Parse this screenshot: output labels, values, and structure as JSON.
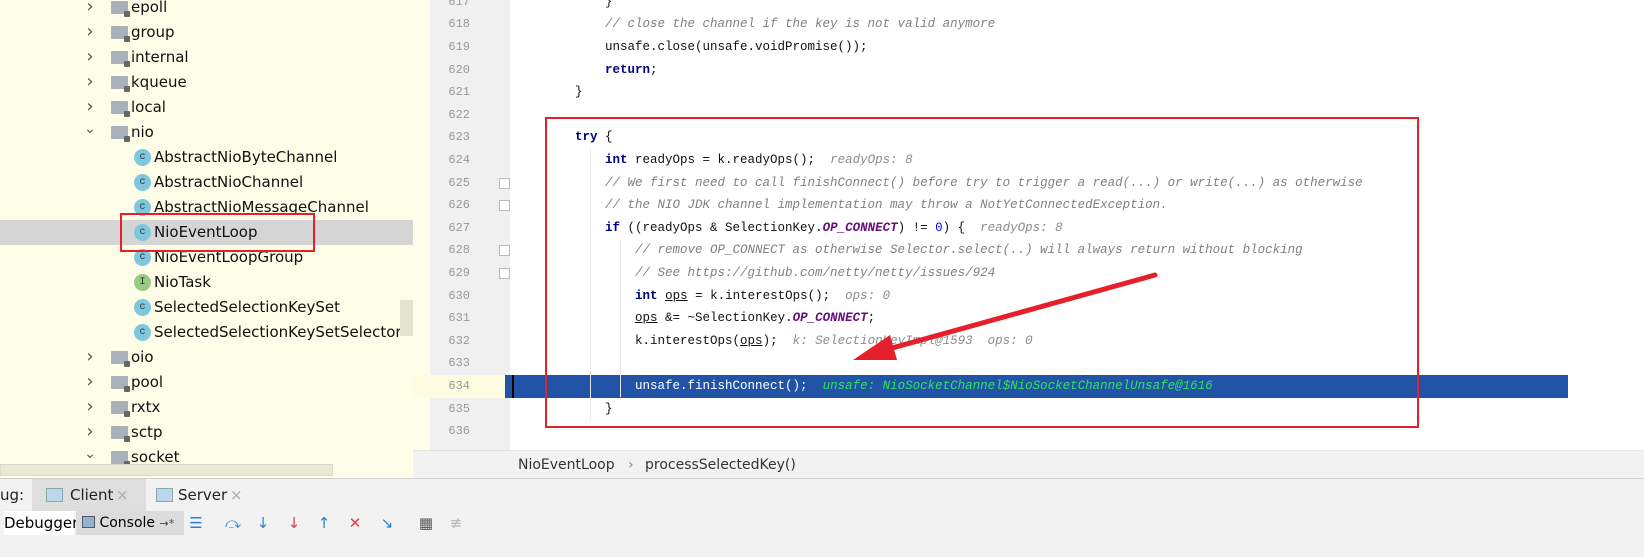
{
  "tree": [
    {
      "type": "folder",
      "label": "epoll",
      "expanded": false,
      "depth": 1
    },
    {
      "type": "folder",
      "label": "group",
      "expanded": false,
      "depth": 1
    },
    {
      "type": "folder",
      "label": "internal",
      "expanded": false,
      "depth": 1
    },
    {
      "type": "folder",
      "label": "kqueue",
      "expanded": false,
      "depth": 1
    },
    {
      "type": "folder",
      "label": "local",
      "expanded": false,
      "depth": 1
    },
    {
      "type": "folder",
      "label": "nio",
      "expanded": true,
      "depth": 1
    },
    {
      "type": "class",
      "label": "AbstractNioByteChannel",
      "depth": 2
    },
    {
      "type": "class",
      "label": "AbstractNioChannel",
      "depth": 2
    },
    {
      "type": "class",
      "label": "AbstractNioMessageChannel",
      "depth": 2
    },
    {
      "type": "class",
      "label": "NioEventLoop",
      "depth": 2,
      "selected": true
    },
    {
      "type": "class",
      "label": "NioEventLoopGroup",
      "depth": 2
    },
    {
      "type": "interface",
      "label": "NioTask",
      "depth": 2
    },
    {
      "type": "class",
      "label": "SelectedSelectionKeySet",
      "depth": 2
    },
    {
      "type": "class",
      "label": "SelectedSelectionKeySetSelector",
      "depth": 2
    },
    {
      "type": "folder",
      "label": "oio",
      "expanded": false,
      "depth": 1
    },
    {
      "type": "folder",
      "label": "pool",
      "expanded": false,
      "depth": 1
    },
    {
      "type": "folder",
      "label": "rxtx",
      "expanded": false,
      "depth": 1
    },
    {
      "type": "folder",
      "label": "sctp",
      "expanded": false,
      "depth": 1
    },
    {
      "type": "folder",
      "label": "socket",
      "expanded": true,
      "depth": 1
    }
  ],
  "editor": {
    "highlight_line": 634,
    "lines": [
      {
        "n": "617",
        "seg": [
          [
            "            }",
            ""
          ]
        ]
      },
      {
        "n": "618",
        "seg": [
          [
            "            // close the channel if the key is not valid anymore",
            "cm"
          ]
        ]
      },
      {
        "n": "619",
        "seg": [
          [
            "            unsafe.close(unsafe.voidPromise());",
            ""
          ]
        ]
      },
      {
        "n": "620",
        "seg": [
          [
            "            ",
            ""
          ],
          [
            "return",
            "kw"
          ],
          [
            ";",
            ""
          ]
        ]
      },
      {
        "n": "621",
        "seg": [
          [
            "        }",
            ""
          ]
        ]
      },
      {
        "n": "622",
        "seg": []
      },
      {
        "n": "623",
        "seg": [
          [
            "        ",
            ""
          ],
          [
            "try",
            "kw"
          ],
          [
            " {",
            ""
          ]
        ]
      },
      {
        "n": "624",
        "seg": [
          [
            "            ",
            ""
          ],
          [
            "int",
            "kw"
          ],
          [
            " readyOps = k.readyOps();  ",
            ""
          ],
          [
            "readyOps: 8",
            "hint"
          ]
        ]
      },
      {
        "n": "625",
        "seg": [
          [
            "            // We first need to call finishConnect() before try to trigger a read(...) or write(...) as otherwise",
            "cm"
          ]
        ]
      },
      {
        "n": "626",
        "seg": [
          [
            "            // the NIO JDK channel implementation may throw a NotYetConnectedException.",
            "cm"
          ]
        ]
      },
      {
        "n": "627",
        "seg": [
          [
            "            ",
            ""
          ],
          [
            "if",
            "kw"
          ],
          [
            " ((readyOps & SelectionKey.",
            ""
          ],
          [
            "OP_CONNECT",
            "cst"
          ],
          [
            ") != ",
            ""
          ],
          [
            "0",
            "num"
          ],
          [
            ") {  ",
            ""
          ],
          [
            "readyOps: 8",
            "hint"
          ]
        ]
      },
      {
        "n": "628",
        "seg": [
          [
            "                // remove OP_CONNECT as otherwise Selector.select(..) will always return without blocking",
            "cm"
          ]
        ]
      },
      {
        "n": "629",
        "seg": [
          [
            "                // See https://github.com/netty/netty/issues/924",
            "cm"
          ]
        ]
      },
      {
        "n": "630",
        "seg": [
          [
            "                ",
            ""
          ],
          [
            "int",
            "kw"
          ],
          [
            " ",
            ""
          ],
          [
            "ops",
            "ul"
          ],
          [
            " = k.interestOps();  ",
            ""
          ],
          [
            "ops: 0",
            "hint"
          ]
        ]
      },
      {
        "n": "631",
        "seg": [
          [
            "                ",
            ""
          ],
          [
            "ops",
            "ul"
          ],
          [
            " &= ~SelectionKey.",
            ""
          ],
          [
            "OP_CONNECT",
            "cst"
          ],
          [
            ";",
            ""
          ]
        ]
      },
      {
        "n": "632",
        "seg": [
          [
            "                k.interestOps(",
            ""
          ],
          [
            "ops",
            "ul"
          ],
          [
            ");  ",
            ""
          ],
          [
            "k: SelectionKeyImpl@1593  ops: 0",
            "hint"
          ]
        ]
      },
      {
        "n": "633",
        "seg": []
      },
      {
        "n": "634",
        "seg": [
          [
            "                unsafe.finishConnect();  ",
            ""
          ],
          [
            "unsafe: NioSocketChannel$NioSocketChannelUnsafe@1616",
            "hint"
          ]
        ]
      },
      {
        "n": "635",
        "seg": [
          [
            "            }",
            ""
          ]
        ]
      },
      {
        "n": "636",
        "seg": []
      }
    ]
  },
  "breadcrumb": {
    "items": [
      "NioEventLoop",
      "processSelectedKey()"
    ],
    "separator": "›"
  },
  "debug": {
    "label": "ug:",
    "tabs": [
      {
        "label": "Client",
        "active": true,
        "close": "×"
      },
      {
        "label": "Server",
        "active": false,
        "close": "×"
      }
    ],
    "toolbar": {
      "debugger": "Debugger",
      "console": "Console",
      "console_pin": "→*"
    }
  },
  "colors": {
    "selection": "#2154a6",
    "annotation": "#e5202a",
    "hint_on_selection": "#2ee35c"
  }
}
